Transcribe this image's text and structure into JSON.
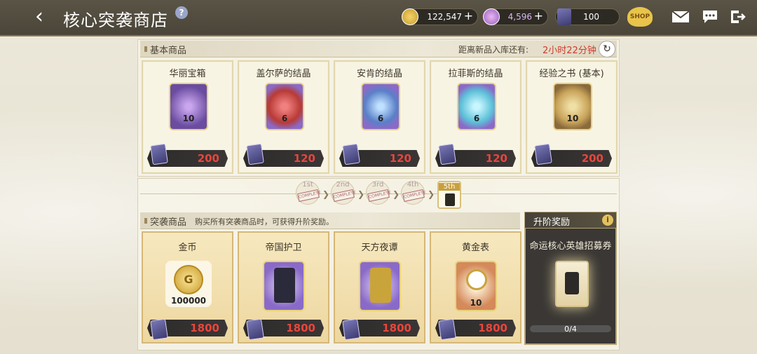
{
  "header": {
    "title": "核心突袭商店",
    "help": "?"
  },
  "currencies": [
    {
      "icon": "gold-coin-icon",
      "value": "122,547"
    },
    {
      "icon": "crystal-gem-icon",
      "value": "4,596"
    },
    {
      "icon": "raid-ticket-icon",
      "value": "100"
    }
  ],
  "shop_label": "SHOP",
  "basic": {
    "section_label": "基本商品",
    "restock_label": "距离新品入库还有:",
    "restock_time": "2小时22分钟",
    "items": [
      {
        "name": "华丽宝箱",
        "qty": "10",
        "price": "200",
        "color": "#6a4ca0"
      },
      {
        "name": "盖尔萨的结晶",
        "qty": "6",
        "price": "120",
        "color": "#b83a35"
      },
      {
        "name": "安肯的结晶",
        "qty": "6",
        "price": "120",
        "color": "#5a80c8"
      },
      {
        "name": "拉菲斯的结晶",
        "qty": "6",
        "price": "120",
        "color": "#5cc0d8"
      },
      {
        "name": "经验之书 (基本)",
        "qty": "10",
        "price": "200",
        "color": "#8a6a3c"
      }
    ]
  },
  "stages": [
    {
      "label": "1st",
      "stamp": "COMPLETE"
    },
    {
      "label": "2nd",
      "stamp": "COMPLETE"
    },
    {
      "label": "3rd",
      "stamp": "COMPLETE"
    },
    {
      "label": "4th",
      "stamp": "COMPLETE"
    },
    {
      "label": "5th"
    }
  ],
  "raid": {
    "section_label": "突袭商品",
    "hint": "购买所有突袭商品时，可获得升阶奖励。",
    "items": [
      {
        "name": "金币",
        "qty": "100000",
        "price": "1800"
      },
      {
        "name": "帝国护卫",
        "price": "1800"
      },
      {
        "name": "天方夜谭",
        "price": "1800"
      },
      {
        "name": "黄金表",
        "qty": "10",
        "price": "1800"
      }
    ]
  },
  "reward": {
    "section_label": "升阶奖励",
    "name": "命运核心英雄招募券",
    "progress_text": "0/4",
    "progress": 0
  }
}
